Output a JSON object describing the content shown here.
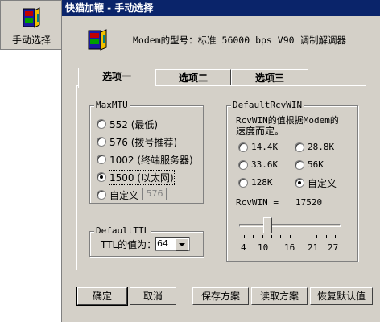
{
  "launcher": {
    "label": "手动选择",
    "icon": "modem-book-icon"
  },
  "window": {
    "title": "快猫加鞭 - 手动选择"
  },
  "modem_info": "Modem的型号：标准 56000 bps V90 调制解调器",
  "tabs": [
    {
      "label": "选项一",
      "active": true
    },
    {
      "label": "选项二",
      "active": false
    },
    {
      "label": "选项三",
      "active": false
    }
  ],
  "maxmtu": {
    "title": "MaxMTU",
    "options": [
      {
        "label": "552 (最低)",
        "checked": false
      },
      {
        "label": "576 (拨号推荐)",
        "checked": false
      },
      {
        "label": "1002 (终端服务器)",
        "checked": false
      },
      {
        "label": "1500 (以太网)",
        "checked": true
      },
      {
        "label": "自定义",
        "checked": false
      }
    ],
    "custom_value": "576"
  },
  "defaultttl": {
    "title": "DefaultTTL",
    "label": "TTL的值为：",
    "value": "64"
  },
  "rcvwin": {
    "title": "DefaultRcvWIN",
    "desc_line1": "RcvWIN的值根据Modem的",
    "desc_line2": "速度而定。",
    "options": [
      {
        "label": "14.4K",
        "checked": false
      },
      {
        "label": "28.8K",
        "checked": false
      },
      {
        "label": "33.6K",
        "checked": false
      },
      {
        "label": "56K",
        "checked": false
      },
      {
        "label": "128K",
        "checked": false
      },
      {
        "label": "自定义",
        "checked": true
      }
    ],
    "value_label": "RcvWIN =",
    "value": "17520",
    "slider_ticks": [
      "4",
      "10",
      "16",
      "21",
      "27"
    ],
    "slider_position": 0.26
  },
  "buttons": {
    "ok": "确定",
    "cancel": "取消",
    "save": "保存方案",
    "load": "读取方案",
    "restore": "恢复默认值"
  }
}
